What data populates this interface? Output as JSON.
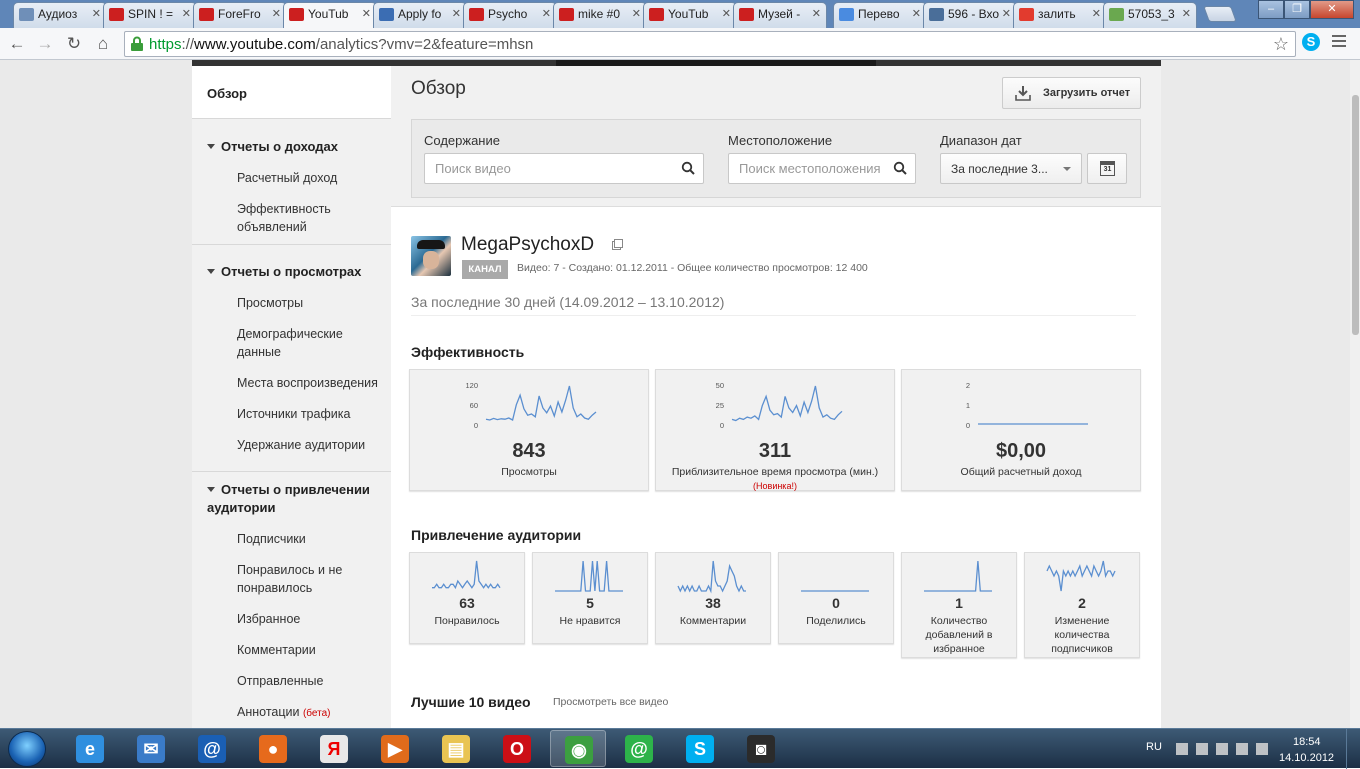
{
  "browser": {
    "tabs": [
      {
        "label": "Аудиоз",
        "color": "#6f8fb8"
      },
      {
        "label": "SPIN ! =",
        "color": "#cc1f1f"
      },
      {
        "label": "ForeFro",
        "color": "#cc1f1f"
      },
      {
        "label": "YouTub",
        "color": "#cc1f1f"
      },
      {
        "label": "Apply fo",
        "color": "#3b6db3"
      },
      {
        "label": "Psycho",
        "color": "#cc1f1f"
      },
      {
        "label": "mike #0",
        "color": "#cc1f1f"
      },
      {
        "label": "YouTub",
        "color": "#cc1f1f"
      },
      {
        "label": "Музей -",
        "color": "#cc1f1f"
      },
      {
        "label": "Перево",
        "color": "#4a8be0"
      },
      {
        "label": "596 - Вхо",
        "color": "#4a6e99"
      },
      {
        "label": "залить",
        "color": "#e23b2e"
      },
      {
        "label": "57053_3",
        "color": "#6aa84f"
      }
    ],
    "active_tab_index": 3,
    "url_scheme": "https",
    "url_host": "www.youtube.com",
    "url_path": "/analytics?vmv=2&feature=mhsn"
  },
  "sidebar": {
    "overview": "Обзор",
    "groups": [
      {
        "title": "Отчеты о доходах",
        "items": [
          "Расчетный доход",
          "Эффективность объявлений"
        ]
      },
      {
        "title": "Отчеты о просмотрах",
        "items": [
          "Просмотры",
          "Демографические данные",
          "Места воспроизведения",
          "Источники трафика",
          "Удержание аудитории"
        ]
      },
      {
        "title": "Отчеты о привлечении аудитории",
        "items": [
          "Подписчики",
          "Понравилось и не понравилось",
          "Избранное",
          "Комментарии",
          "Отправленные",
          "Аннотации"
        ]
      }
    ],
    "beta_label": "(бета)"
  },
  "header": {
    "title": "Обзор",
    "download_button": "Загрузить отчет",
    "filters": {
      "content_label": "Содержание",
      "content_placeholder": "Поиск видео",
      "location_label": "Местоположение",
      "location_placeholder": "Поиск местоположения",
      "date_label": "Диапазон дат",
      "date_value": "За последние 3...",
      "calendar_day": "31"
    }
  },
  "channel": {
    "name": "MegaPsychoxD",
    "badge": "КАНАЛ",
    "meta": "Видео: 7  -  Создано: 01.12.2011  -  Общее количество просмотров: 12 400",
    "period": "За последние 30 дней (14.09.2012 – 13.10.2012)"
  },
  "performance": {
    "title": "Эффективность",
    "cards": [
      {
        "value": "843",
        "label": "Просмотры",
        "note": "",
        "axis": [
          "120",
          "60",
          "0"
        ],
        "spark": [
          12,
          10,
          14,
          11,
          13,
          12,
          15,
          10,
          48,
          72,
          38,
          22,
          25,
          18,
          70,
          40,
          28,
          45,
          20,
          55,
          30,
          60,
          95,
          40,
          18,
          25,
          15,
          12,
          22,
          30
        ]
      },
      {
        "value": "311",
        "label": "Приблизительное время просмотра (мин.)",
        "note": "(Новинка!)",
        "axis": [
          "50",
          "25",
          "0"
        ],
        "spark": [
          4,
          3,
          5,
          4,
          6,
          5,
          7,
          4,
          16,
          24,
          12,
          8,
          9,
          6,
          24,
          14,
          10,
          16,
          7,
          19,
          10,
          20,
          33,
          14,
          6,
          8,
          5,
          4,
          8,
          11
        ]
      },
      {
        "value": "$0,00",
        "label": "Общий расчетный доход",
        "note": "",
        "axis": [
          "2",
          "1",
          "0"
        ],
        "spark": [
          0,
          0,
          0,
          0,
          0,
          0,
          0,
          0,
          0,
          0,
          0,
          0,
          0,
          0,
          0,
          0,
          0,
          0,
          0,
          0,
          0,
          0,
          0,
          0,
          0,
          0,
          0,
          0,
          0,
          0
        ]
      }
    ]
  },
  "engagement": {
    "title": "Привлечение аудитории",
    "cards": [
      {
        "value": "63",
        "label": "Понравилось",
        "spark": [
          1,
          1,
          2,
          1,
          1,
          2,
          1,
          1,
          2,
          2,
          1,
          3,
          2,
          1,
          2,
          3,
          2,
          1,
          2,
          9,
          3,
          2,
          1,
          2,
          1,
          2,
          1,
          1,
          2,
          1
        ]
      },
      {
        "value": "5",
        "label": "Не нравится",
        "spark": [
          0,
          0,
          0,
          0,
          0,
          0,
          0,
          0,
          0,
          0,
          0,
          0,
          1,
          0,
          0,
          0,
          1,
          0,
          1,
          0,
          0,
          0,
          1,
          0,
          0,
          0,
          0,
          0,
          0,
          0
        ]
      },
      {
        "value": "38",
        "label": "Комментарии",
        "spark": [
          1,
          0,
          1,
          0,
          1,
          0,
          1,
          0,
          0,
          1,
          0,
          0,
          0,
          1,
          0,
          6,
          2,
          1,
          1,
          0,
          1,
          2,
          5,
          4,
          3,
          1,
          0,
          1,
          0,
          0
        ]
      },
      {
        "value": "0",
        "label": "Поделились",
        "spark": [
          0,
          0,
          0,
          0,
          0,
          0,
          0,
          0,
          0,
          0,
          0,
          0,
          0,
          0,
          0,
          0,
          0,
          0,
          0,
          0,
          0,
          0,
          0,
          0,
          0,
          0,
          0,
          0,
          0,
          0
        ]
      },
      {
        "value": "1",
        "label": "Количество добавлений в избранное",
        "spark": [
          0,
          0,
          0,
          0,
          0,
          0,
          0,
          0,
          0,
          0,
          0,
          0,
          0,
          0,
          0,
          0,
          0,
          0,
          0,
          0,
          0,
          0,
          0,
          1,
          0,
          0,
          0,
          0,
          0,
          0
        ]
      },
      {
        "value": "2",
        "label": "Изменение количества подписчиков",
        "spark": [
          1,
          2,
          1,
          0,
          1,
          0,
          -3,
          1,
          0,
          1,
          0,
          1,
          0,
          1,
          2,
          0,
          1,
          2,
          1,
          0,
          2,
          1,
          0,
          1,
          3,
          0,
          1,
          1,
          0,
          1
        ]
      }
    ]
  },
  "top_videos": {
    "title": "Лучшие 10 видео",
    "link": "Просмотреть все видео"
  },
  "taskbar": {
    "apps": [
      {
        "name": "ie",
        "color": "#2f8fdf",
        "glyph": "e"
      },
      {
        "name": "mail",
        "color": "#3a7bc8",
        "glyph": "✉"
      },
      {
        "name": "mailru",
        "color": "#1a5fb4",
        "glyph": "@"
      },
      {
        "name": "firefox",
        "color": "#e66a1c",
        "glyph": "●"
      },
      {
        "name": "yandex",
        "color": "#e8e8e8",
        "glyph": "Я"
      },
      {
        "name": "media",
        "color": "#e06b1b",
        "glyph": "▶"
      },
      {
        "name": "explorer",
        "color": "#e9c452",
        "glyph": "▤"
      },
      {
        "name": "opera",
        "color": "#cc0f16",
        "glyph": "O"
      },
      {
        "name": "chrome",
        "color": "#3c9f40",
        "glyph": "◉"
      },
      {
        "name": "agent",
        "color": "#2db34a",
        "glyph": "@"
      },
      {
        "name": "skype",
        "color": "#00aff0",
        "glyph": "S"
      },
      {
        "name": "webcam",
        "color": "#2b2b2b",
        "glyph": "◙"
      }
    ],
    "active_app_index": 8,
    "language": "RU",
    "time": "18:54",
    "date": "14.10.2012"
  }
}
